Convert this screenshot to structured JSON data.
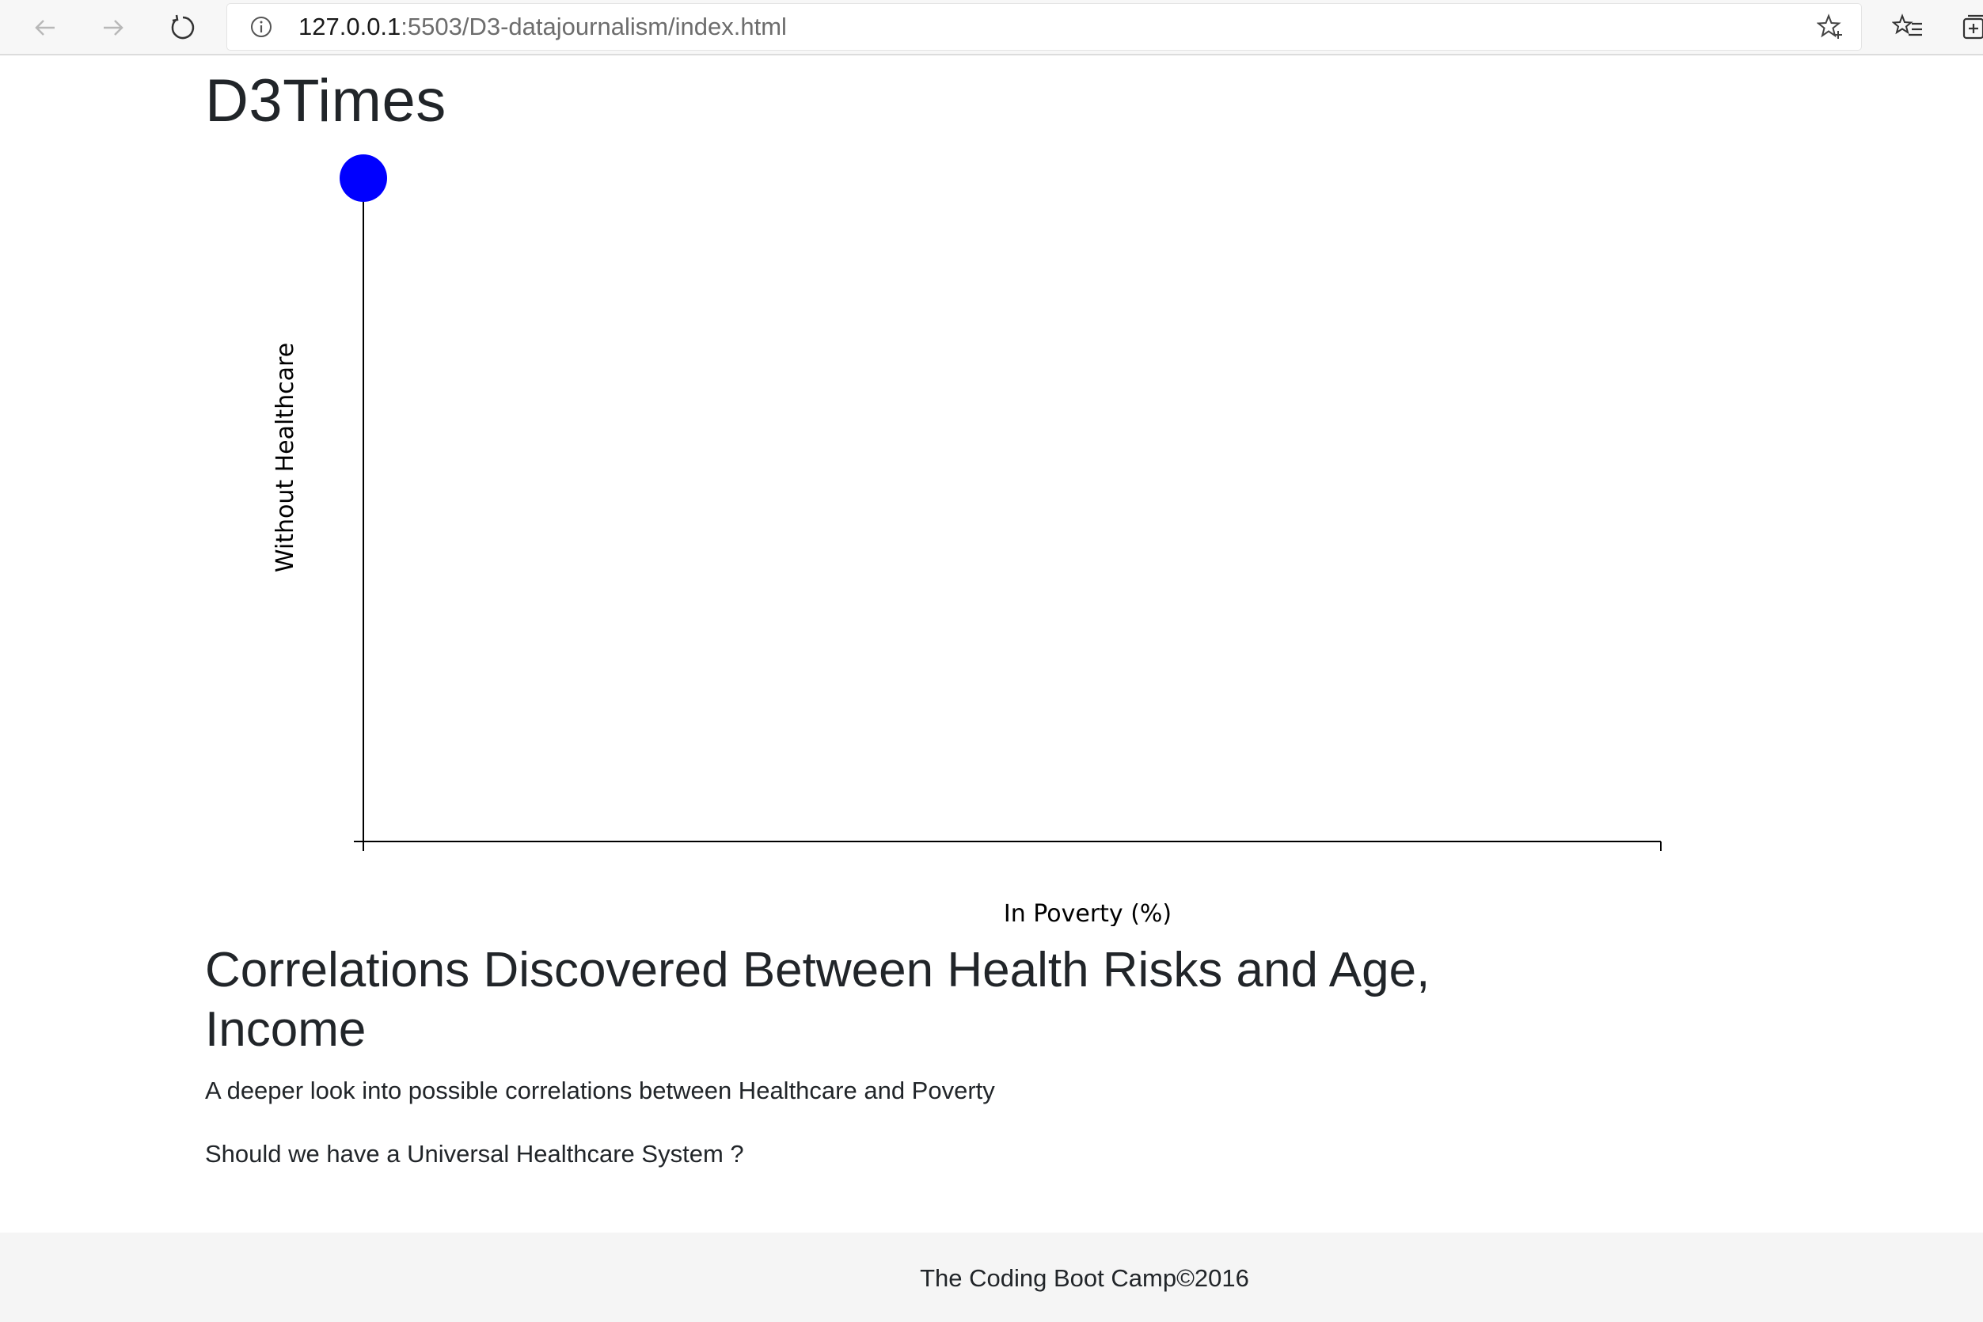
{
  "browser": {
    "url_host": "127.0.0.1",
    "url_rest": ":5503/D3-datajournalism/index.html",
    "back_icon": "arrow-left-icon",
    "forward_icon": "arrow-right-icon",
    "refresh_icon": "refresh-icon",
    "info_icon": "info-icon",
    "star_icon": "star-add-icon",
    "favorites_icon": "favorites-list-icon",
    "collections_icon": "collections-icon"
  },
  "page": {
    "title": "D3Times",
    "heading": "Correlations Discovered Between Health Risks and Age, Income",
    "subtitle": "A deeper look into possible correlations between Healthcare and Poverty",
    "question": "Should we have a Universal Healthcare System ?",
    "footer": "The Coding Boot Camp©2016"
  },
  "chart_data": {
    "type": "scatter",
    "title": "",
    "xlabel": "In Poverty (%)",
    "ylabel": "Without Healthcare",
    "x_ticks": [],
    "y_ticks": [],
    "series": [
      {
        "values": [
          {
            "x": 0,
            "y": 1
          }
        ]
      }
    ],
    "xlim": [
      0,
      1
    ],
    "ylim": [
      0,
      1
    ],
    "grid": false,
    "point_color": "#0000ff"
  }
}
